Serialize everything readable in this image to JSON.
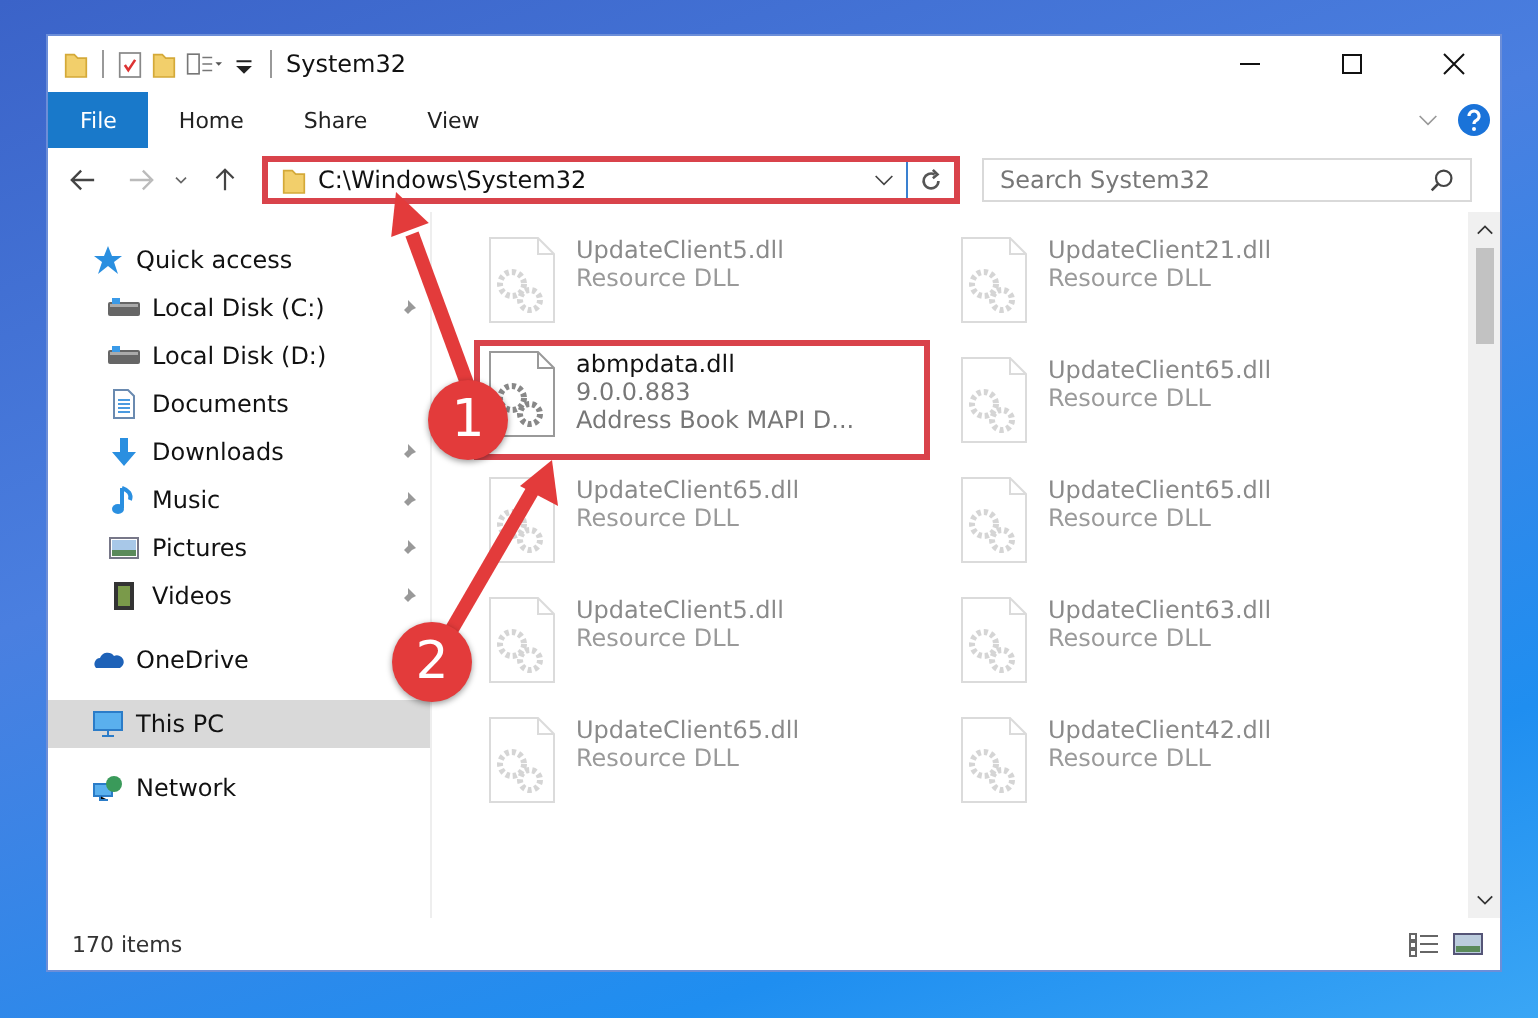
{
  "window": {
    "title": "System32"
  },
  "ribbon": {
    "tabs": [
      {
        "label": "File",
        "selected": true
      },
      {
        "label": "Home",
        "selected": false
      },
      {
        "label": "Share",
        "selected": false
      },
      {
        "label": "View",
        "selected": false
      }
    ]
  },
  "address": {
    "path": "C:\\Windows\\System32",
    "highlighted": true
  },
  "search": {
    "placeholder": "Search System32"
  },
  "sidebar": {
    "items": [
      {
        "label": "Quick access",
        "kind": "star",
        "selected": false,
        "children": [
          {
            "label": "Local Disk (C:)",
            "kind": "drive",
            "pinned": true,
            "selected": false
          },
          {
            "label": "Local Disk (D:)",
            "kind": "drive",
            "pinned": false,
            "selected": false
          },
          {
            "label": "Documents",
            "kind": "docs",
            "pinned": false,
            "selected": false
          },
          {
            "label": "Downloads",
            "kind": "download",
            "pinned": true,
            "selected": false
          },
          {
            "label": "Music",
            "kind": "music",
            "pinned": true,
            "selected": false
          },
          {
            "label": "Pictures",
            "kind": "pictures",
            "pinned": true,
            "selected": false
          },
          {
            "label": "Videos",
            "kind": "videos",
            "pinned": true,
            "selected": false
          }
        ]
      },
      {
        "label": "OneDrive",
        "kind": "cloud",
        "selected": false
      },
      {
        "label": "This PC",
        "kind": "pc",
        "selected": true
      },
      {
        "label": "Network",
        "kind": "network",
        "selected": false
      }
    ]
  },
  "files": [
    {
      "name": "UpdateClient5.dll",
      "detail": "Resource DLL",
      "faded": true,
      "highlighted": false
    },
    {
      "name": "UpdateClient21.dll",
      "detail": "Resource DLL",
      "faded": true,
      "highlighted": false
    },
    {
      "name": "abmpdata.dll",
      "version": "9.0.0.883",
      "detail": "Address Book MAPI D...",
      "faded": false,
      "highlighted": true
    },
    {
      "name": "UpdateClient65.dll",
      "detail": "Resource DLL",
      "faded": true,
      "highlighted": false
    },
    {
      "name": "UpdateClient65.dll",
      "detail": "Resource DLL",
      "faded": true,
      "highlighted": false
    },
    {
      "name": "UpdateClient65.dll",
      "detail": "Resource DLL",
      "faded": true,
      "highlighted": false
    },
    {
      "name": "UpdateClient5.dll",
      "detail": "Resource DLL",
      "faded": true,
      "highlighted": false
    },
    {
      "name": "UpdateClient63.dll",
      "detail": "Resource DLL",
      "faded": true,
      "highlighted": false
    },
    {
      "name": "UpdateClient65.dll",
      "detail": "Resource DLL",
      "faded": true,
      "highlighted": false
    },
    {
      "name": "UpdateClient42.dll",
      "detail": "Resource DLL",
      "faded": true,
      "highlighted": false
    }
  ],
  "status_bar": {
    "count": "170 items"
  },
  "annotations": [
    {
      "label": "1"
    },
    {
      "label": "2"
    }
  ]
}
